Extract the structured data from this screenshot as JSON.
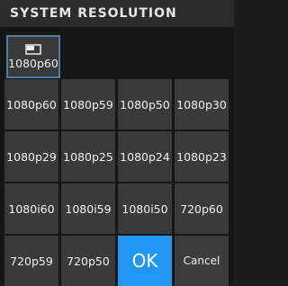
{
  "title": "SYSTEM RESOLUTION",
  "current": {
    "icon": "picture-in-picture-icon",
    "label": "1080p60"
  },
  "rows": [
    [
      "1080p60",
      "1080p59",
      "1080p50",
      "1080p30"
    ],
    [
      "1080p29",
      "1080p25",
      "1080p24",
      "1080p23"
    ],
    [
      "1080i60",
      "1080i59",
      "1080i50",
      "720p60"
    ],
    [
      "720p59",
      "720p50"
    ]
  ],
  "actions": {
    "ok_label": "OK",
    "cancel_label": "Cancel"
  },
  "colors": {
    "accent": "#2196f3",
    "selection_border": "#4a7fae",
    "cell_bg": "#3a3a3a"
  }
}
